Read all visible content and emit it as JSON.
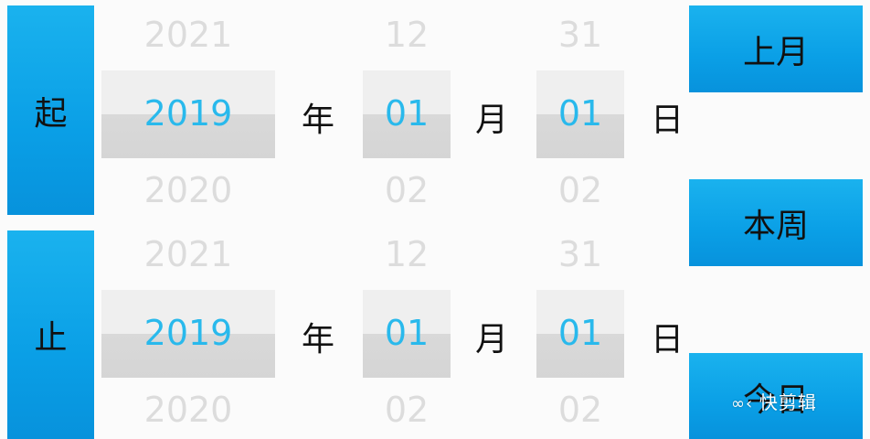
{
  "start_row": {
    "label": "起",
    "year": {
      "prev": "2021",
      "current": "2019",
      "next": "2020"
    },
    "month": {
      "prev": "12",
      "current": "01",
      "next": "02"
    },
    "day": {
      "prev": "31",
      "current": "01",
      "next": "02"
    },
    "units": {
      "year": "年",
      "month": "月",
      "day": "日"
    }
  },
  "end_row": {
    "label": "止",
    "year": {
      "prev": "2021",
      "current": "2019",
      "next": "2020"
    },
    "month": {
      "prev": "12",
      "current": "01",
      "next": "02"
    },
    "day": {
      "prev": "31",
      "current": "01",
      "next": "02"
    },
    "units": {
      "year": "年",
      "month": "月",
      "day": "日"
    }
  },
  "quick_buttons": {
    "last_month": "上月",
    "this_week": "本周",
    "today": "今日"
  },
  "watermark": "快剪辑",
  "colors": {
    "button_blue": "#0a9fe6",
    "selected_text": "#29b9ec",
    "faded_text": "#dcdcdc"
  }
}
